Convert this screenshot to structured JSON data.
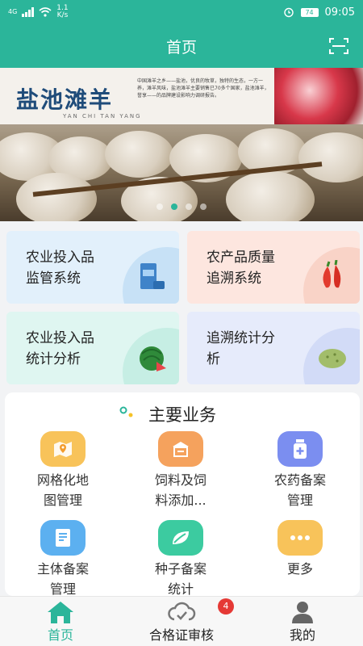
{
  "statusbar": {
    "network": "4G",
    "speed_value": "1.1",
    "speed_unit": "K/s",
    "battery": "74",
    "time": "09:05",
    "alarm_icon": "alarm-icon",
    "wifi_icon": "wifi-icon"
  },
  "appbar": {
    "title": "首页",
    "scan_icon": "scan-icon"
  },
  "banner": {
    "logo": "盐池滩羊",
    "logo_sub": "YAN CHI TAN YANG",
    "text": "中国滩羊之乡——盐池，优良的牧草，独特的生态，一方一养，滩羊风味，盐池滩羊主要销售已70多个国家，盐池滩羊，誉享——的品牌建设影响力调研报告。",
    "slides": 4,
    "active_slide": 2
  },
  "cards": [
    {
      "title_line1": "农业投入品",
      "title_line2": "监管系统",
      "icon": "feed-bag-icon",
      "bg": "#e2f0fb",
      "circle": "#c7e1f6"
    },
    {
      "title_line1": "农产品质量",
      "title_line2": "追溯系统",
      "icon": "chili-pepper-icon",
      "bg": "#fde6df",
      "circle": "#f9d3c7"
    },
    {
      "title_line1": "农业投入品",
      "title_line2": "统计分析",
      "icon": "watermelon-icon",
      "bg": "#dff6f1",
      "circle": "#c6eee4"
    },
    {
      "title_line1": "追溯统计分",
      "title_line2": "析",
      "icon": "potato-icon",
      "bg": "#e6ebfb",
      "circle": "#d2dbf7"
    }
  ],
  "business": {
    "title": "主要业务",
    "items": [
      {
        "line1": "网格化地",
        "line2": "图管理",
        "icon": "map-location-icon",
        "color": "#f8c35a"
      },
      {
        "line1": "饲料及饲",
        "line2": "料添加...",
        "icon": "feed-box-icon",
        "color": "#f5a25d"
      },
      {
        "line1": "农药备案",
        "line2": "管理",
        "icon": "medicine-bottle-icon",
        "color": "#7b8ef0"
      },
      {
        "line1": "主体备案",
        "line2": "管理",
        "icon": "document-icon",
        "color": "#5cb0f0"
      },
      {
        "line1": "种子备案",
        "line2": "统计",
        "icon": "leaf-icon",
        "color": "#3ccba0"
      },
      {
        "line1": "更多",
        "line2": "",
        "icon": "more-dots-icon",
        "color": "#f8c35a"
      }
    ]
  },
  "tabbar": {
    "tabs": [
      {
        "label": "首页",
        "icon": "home-icon",
        "active": true
      },
      {
        "label": "合格证审核",
        "icon": "certificate-cloud-icon",
        "active": false
      },
      {
        "label": "我的",
        "icon": "user-icon",
        "active": false
      }
    ],
    "badge": "4"
  },
  "colors": {
    "accent": "#2bb59a",
    "badge": "#e53935"
  }
}
